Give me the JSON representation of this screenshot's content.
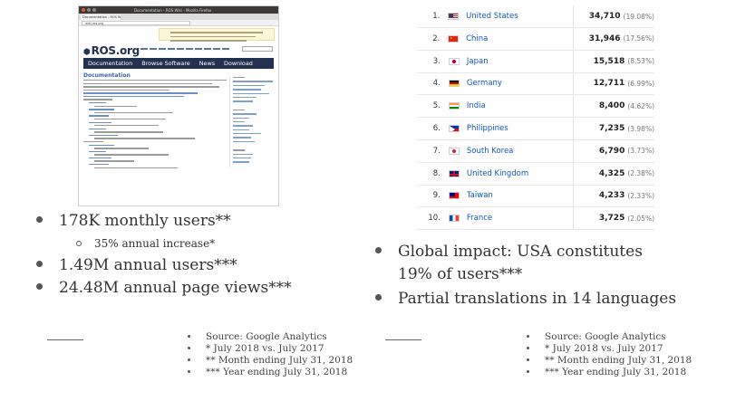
{
  "browser_shot": {
    "window_title": "Documentation - ROS Wiki - Mozilla Firefox",
    "tab_label": "Documentation - ROS Wiki",
    "url": "wiki.ros.org",
    "logo": "ROS.org",
    "nav": [
      "Documentation",
      "Browse Software",
      "News",
      "Download"
    ],
    "heading": "Documentation"
  },
  "left_bullets": [
    {
      "level": 1,
      "text": "178K monthly users**"
    },
    {
      "level": 2,
      "text": "35% annual increase*"
    },
    {
      "level": 1,
      "text": "1.49M annual users***"
    },
    {
      "level": 1,
      "text": "24.48M annual page views***"
    }
  ],
  "countries": [
    {
      "rank": "1.",
      "name": "United States",
      "users": "34,710",
      "pct": "(19.08%)",
      "flag": "us"
    },
    {
      "rank": "2.",
      "name": "China",
      "users": "31,946",
      "pct": "(17.56%)",
      "flag": "cn"
    },
    {
      "rank": "3.",
      "name": "Japan",
      "users": "15,518",
      "pct": "(8.53%)",
      "flag": "jp"
    },
    {
      "rank": "4.",
      "name": "Germany",
      "users": "12,711",
      "pct": "(6.99%)",
      "flag": "de"
    },
    {
      "rank": "5.",
      "name": "India",
      "users": "8,400",
      "pct": "(4.62%)",
      "flag": "in"
    },
    {
      "rank": "6.",
      "name": "Philippines",
      "users": "7,235",
      "pct": "(3.98%)",
      "flag": "ph"
    },
    {
      "rank": "7.",
      "name": "South Korea",
      "users": "6,790",
      "pct": "(3.73%)",
      "flag": "kr"
    },
    {
      "rank": "8.",
      "name": "United Kingdom",
      "users": "4,325",
      "pct": "(2.38%)",
      "flag": "gb"
    },
    {
      "rank": "9.",
      "name": "Taiwan",
      "users": "4,233",
      "pct": "(2.33%)",
      "flag": "tw"
    },
    {
      "rank": "10.",
      "name": "France",
      "users": "3,725",
      "pct": "(2.05%)",
      "flag": "fr"
    }
  ],
  "right_bullets": {
    "global_line1": "Global impact: USA constitutes",
    "global_line2": "19% of users***",
    "translations": "Partial translations in 14 languages"
  },
  "footnotes": [
    "Source: Google Analytics",
    "* July 2018 vs. July 2017",
    "** Month ending July 31, 2018",
    "*** Year ending July 31, 2018"
  ]
}
